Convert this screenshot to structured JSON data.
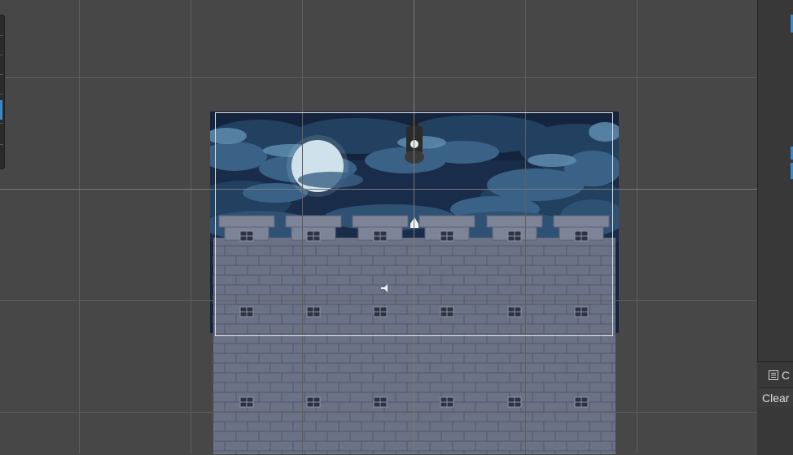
{
  "scene": {
    "colors": {
      "sky": "#14243f",
      "cloud_dark": "#22405f",
      "cloud_mid": "#3a6286",
      "cloud_light": "#5f8cae",
      "moon": "#cfe2ec",
      "wall": "#6b7286",
      "brick_line": "#52586b",
      "window": "#2e3342",
      "crenel": "#7d8498"
    },
    "icons": {
      "moon": "moon-sprite",
      "light": "light-gizmo-icon",
      "audio": "audio-source-icon",
      "lantern": "hanging-lantern-sprite"
    }
  },
  "console": {
    "tab_label": "C",
    "tab_icon": "console-icon",
    "clear_label": "Clear"
  }
}
